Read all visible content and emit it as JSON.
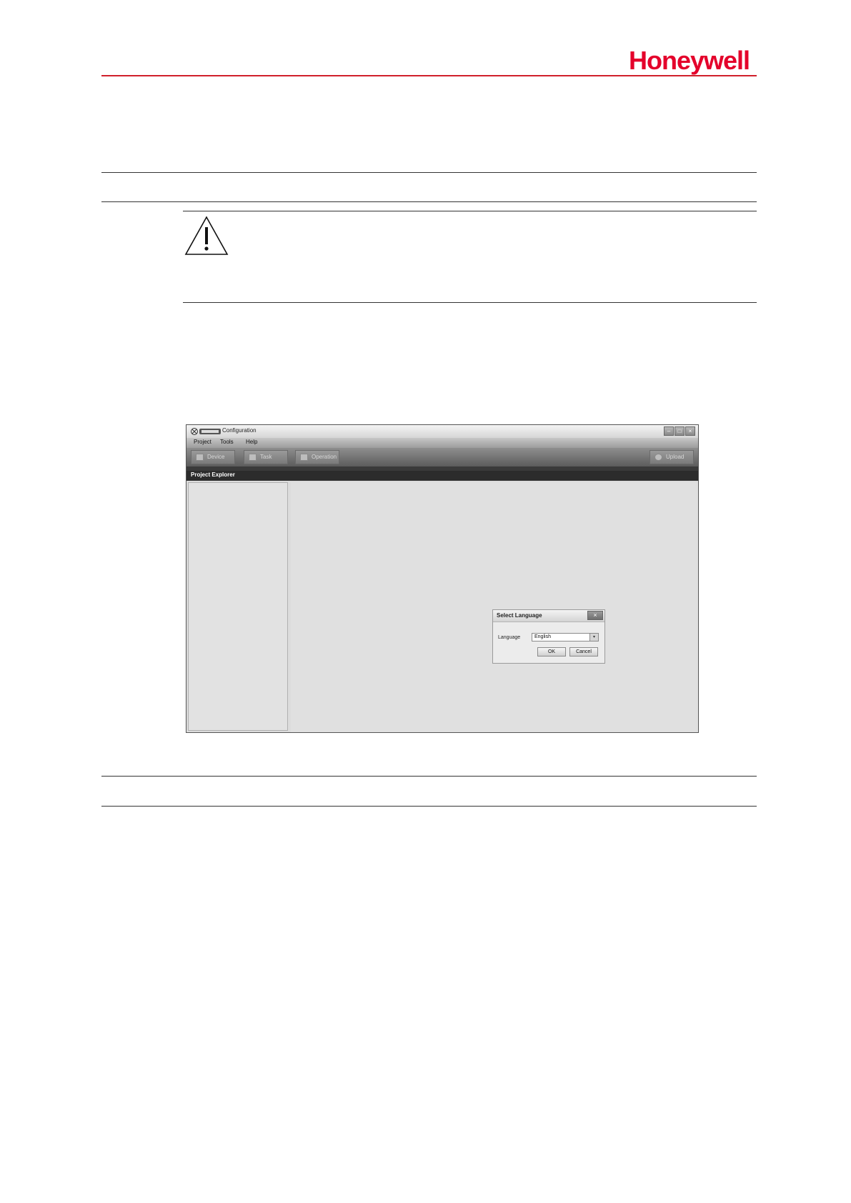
{
  "header": {
    "brand": "Honeywell",
    "brand_color": "#e4002b"
  },
  "app": {
    "title": "Configuration",
    "window_buttons": [
      "–",
      "□",
      "×"
    ],
    "menu": [
      "Project",
      "Tools",
      "Help"
    ],
    "toolbar": {
      "device": "Device",
      "task": "Task",
      "operation": "Operation",
      "upload": "Upload"
    },
    "explorer_title": "Project Explorer",
    "dialog": {
      "title": "Select Language",
      "close": "×",
      "label": "Language",
      "selected": "English",
      "ok": "OK",
      "cancel": "Cancel"
    }
  }
}
